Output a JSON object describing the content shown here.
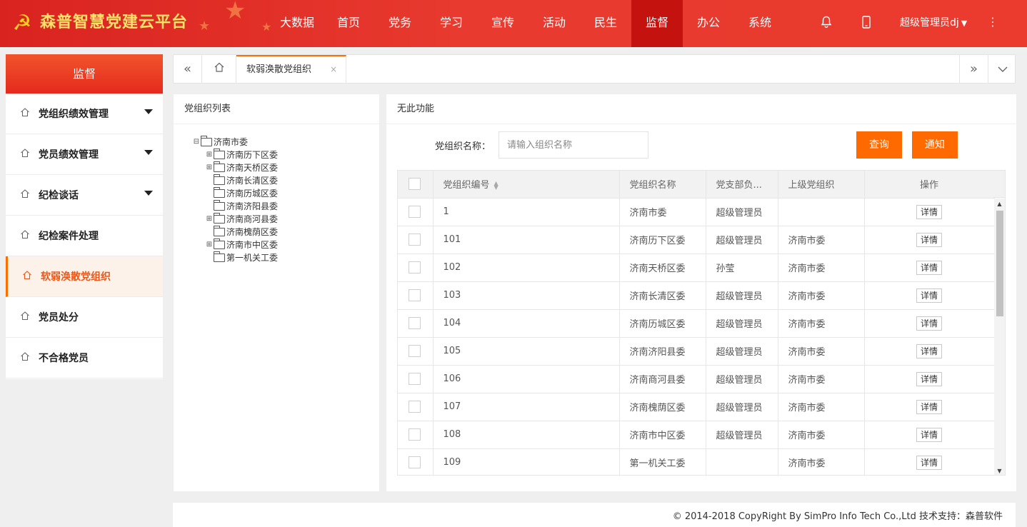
{
  "header": {
    "brand": "森普智慧党建云平台",
    "nav": [
      {
        "label": "大数据"
      },
      {
        "label": "首页"
      },
      {
        "label": "党务"
      },
      {
        "label": "学习"
      },
      {
        "label": "宣传"
      },
      {
        "label": "活动"
      },
      {
        "label": "民生"
      },
      {
        "label": "监督",
        "active": true
      },
      {
        "label": "办公"
      },
      {
        "label": "系统"
      }
    ],
    "user": "超级管理员dj",
    "icons": [
      "party-emblem-icon",
      "bell-icon",
      "mobile-icon",
      "more-vertical-icon"
    ]
  },
  "sidebar": {
    "title": "监督",
    "items": [
      {
        "label": "党组织绩效管理",
        "expandable": true
      },
      {
        "label": "党员绩效管理",
        "expandable": true
      },
      {
        "label": "纪检谈话",
        "expandable": true
      },
      {
        "label": "纪检案件处理"
      },
      {
        "label": "软弱涣散党组织",
        "active": true
      },
      {
        "label": "党员处分"
      },
      {
        "label": "不合格党员"
      }
    ]
  },
  "tabs": {
    "items": [
      {
        "label": "软弱涣散党组织",
        "close": "×"
      }
    ]
  },
  "tree": {
    "title": "党组织列表",
    "root": "济南市委",
    "children": [
      {
        "label": "济南历下区委",
        "expandable": true
      },
      {
        "label": "济南天桥区委",
        "expandable": true
      },
      {
        "label": "济南长清区委"
      },
      {
        "label": "济南历城区委"
      },
      {
        "label": "济南济阳县委"
      },
      {
        "label": "济南商河县委",
        "expandable": true
      },
      {
        "label": "济南槐荫区委"
      },
      {
        "label": "济南市中区委",
        "expandable": true
      },
      {
        "label": "第一机关工委"
      }
    ]
  },
  "main": {
    "title": "无此功能",
    "search": {
      "label": "党组织名称：",
      "placeholder": "请输入组织名称",
      "value": ""
    },
    "buttons": {
      "query": "查询",
      "notify": "通知"
    },
    "table": {
      "columns": [
        "党组织编号",
        "党组织名称",
        "党支部负...",
        "上级党组织",
        "操作"
      ],
      "detail_label": "详情",
      "rows": [
        [
          "1",
          "济南市委",
          "超级管理员",
          ""
        ],
        [
          "101",
          "济南历下区委",
          "超级管理员",
          "济南市委"
        ],
        [
          "102",
          "济南天桥区委",
          "孙莹",
          "济南市委"
        ],
        [
          "103",
          "济南长清区委",
          "超级管理员",
          "济南市委"
        ],
        [
          "104",
          "济南历城区委",
          "超级管理员",
          "济南市委"
        ],
        [
          "105",
          "济南济阳县委",
          "超级管理员",
          "济南市委"
        ],
        [
          "106",
          "济南商河县委",
          "超级管理员",
          "济南市委"
        ],
        [
          "107",
          "济南槐荫区委",
          "超级管理员",
          "济南市委"
        ],
        [
          "108",
          "济南市中区委",
          "超级管理员",
          "济南市委"
        ],
        [
          "109",
          "第一机关工委",
          "",
          "济南市委"
        ]
      ]
    }
  },
  "footer": {
    "copyright": "© 2014-2018 CopyRight By SimPro Info Tech Co.,Ltd 技术支持：森普软件"
  },
  "colors": {
    "header_red": "#e83a2f",
    "active_nav": "#c4120f",
    "accent_orange": "#ff6a00",
    "brand_yellow": "#ffe16a"
  }
}
